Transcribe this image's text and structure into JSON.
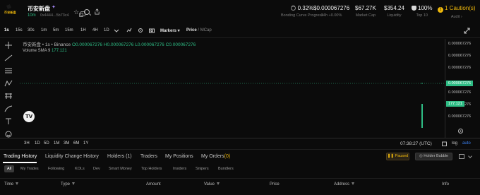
{
  "token": {
    "name": "币安新盘",
    "logo_text": "币安新盘",
    "age": "10m",
    "address": "0x4444...5b73c4",
    "icons": {
      "favorite": "star-icon",
      "search": "search-icon",
      "share": "share-icon",
      "copy": "copy-icon",
      "sparkle": "sparkle-icon"
    }
  },
  "stats": [
    {
      "value": "0.32%",
      "label": "Bonding Curve Progress",
      "icon": "progress-ring-icon"
    },
    {
      "value": "$0.000067276",
      "label": "24h +0.00%"
    },
    {
      "value": "$67.27K",
      "label": "Market Cap"
    },
    {
      "value": "$354.24",
      "label": "Liquidity"
    },
    {
      "value": "100%",
      "label": "Top 10",
      "icon": "shield-icon"
    },
    {
      "value": "1 Caution(s)",
      "label": "Audit",
      "icon": "caution-icon"
    }
  ],
  "toolbar": {
    "timeframes": [
      "1s",
      "15s",
      "30s",
      "1m",
      "5m",
      "15m",
      "1H",
      "4H",
      "1D"
    ],
    "active_timeframe": "1s",
    "markers_label": "Markers",
    "price_label": "Price",
    "mcap_label": "MCap"
  },
  "chart_legend": {
    "pair": "币安新盘 • 1s • Binance",
    "ohlc": "O0.000067276 H0.000067276 L0.000067276 C0.000067276",
    "volume_label": "Volume SMA 9",
    "volume_value": "177.121"
  },
  "price_axis": {
    "ticks": [
      "0.000067276",
      "0.000067276",
      "0.000067276",
      "0.000067276",
      "0.000067276",
      "0.000067276",
      "0.000067276"
    ],
    "current_price": "0.000067276",
    "volume_badge": "177.121"
  },
  "time_axis": {
    "ranges": [
      "3H",
      "1D",
      "5D",
      "1M",
      "3M",
      "6M",
      "1Y"
    ],
    "time_readout": "07:38:27 (UTC)",
    "log_label": "log",
    "auto_label": "auto"
  },
  "chart_data": {
    "type": "bar",
    "interval": "1s",
    "price": 6.7276e-05,
    "ohlc": {
      "open": 6.7276e-05,
      "high": 6.7276e-05,
      "low": 6.7276e-05,
      "close": 6.7276e-05
    },
    "volume": [
      177.121
    ],
    "volume_sma_9": 177.121
  },
  "tabs": {
    "items": [
      "Trading History",
      "Liquidity Change History",
      "Holders (1)",
      "Traders",
      "My Positions",
      "My Orders"
    ],
    "orders_count": "(0)",
    "active": "Trading History",
    "paused_label": "Paused",
    "holder_bubble_label": "Holder Bubble"
  },
  "filters": [
    "All",
    "My Trades",
    "Following",
    "KOLs",
    "Dev",
    "Smart Money",
    "Top Holders",
    "Insiders",
    "Snipers",
    "Bundlers"
  ],
  "table_headers": [
    "Time",
    "Type",
    "Amount",
    "Value",
    "Price",
    "Address",
    "Info"
  ],
  "colors": {
    "up": "#2ebd85",
    "accent": "#f0b90b",
    "background": "#0b0b0b"
  }
}
